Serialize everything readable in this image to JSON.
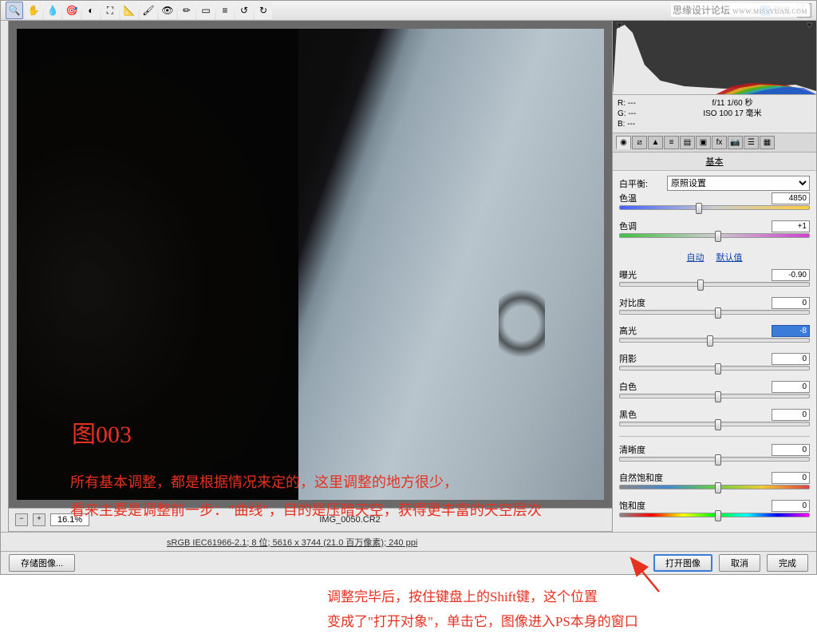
{
  "watermark": {
    "site": "思缘设计论坛",
    "url": "WWW.MISSYUAN.COM"
  },
  "toolbar": {
    "preview_label": "预览"
  },
  "exif": {
    "r": "R: ---",
    "g": "G: ---",
    "b": "B: ---",
    "line1": "f/11  1/60 秒",
    "line2": "ISO 100  17 毫米"
  },
  "panel": {
    "title": "基本",
    "wb_label": "白平衡:",
    "wb_value": "原照设置",
    "temp_label": "色温",
    "temp_value": "4850",
    "tint_label": "色调",
    "tint_value": "+1",
    "auto": "自动",
    "default": "默认值",
    "exposure_label": "曝光",
    "exposure_value": "-0.90",
    "contrast_label": "对比度",
    "contrast_value": "0",
    "highlights_label": "高光",
    "highlights_value": "-8",
    "shadows_label": "阴影",
    "shadows_value": "0",
    "whites_label": "白色",
    "whites_value": "0",
    "blacks_label": "黑色",
    "blacks_value": "0",
    "clarity_label": "清晰度",
    "clarity_value": "0",
    "vibrance_label": "自然饱和度",
    "vibrance_value": "0",
    "saturation_label": "饱和度",
    "saturation_value": "0"
  },
  "filmstrip": {
    "zoom": "16.1%",
    "filename": "IMG_0050.CR2"
  },
  "status": {
    "info": "sRGB IEC61966-2.1; 8 位; 5616 x 3744 (21.0 百万像素); 240 ppi"
  },
  "footer": {
    "save_image": "存储图像...",
    "open_image": "打开图像",
    "cancel": "取消",
    "done": "完成"
  },
  "overlays": {
    "fig": "图003",
    "line1": "所有基本调整，都是根据情况来定的，这里调整的地方很少，",
    "line2": "看来主要是调整前一步：\"曲线\"，目的是压暗天空，获得更丰富的天空层次",
    "anno1": "调整完毕后，按住键盘上的Shift键，这个位置",
    "anno2": "变成了\"打开对象\"，单击它，图像进入PS本身的窗口"
  }
}
